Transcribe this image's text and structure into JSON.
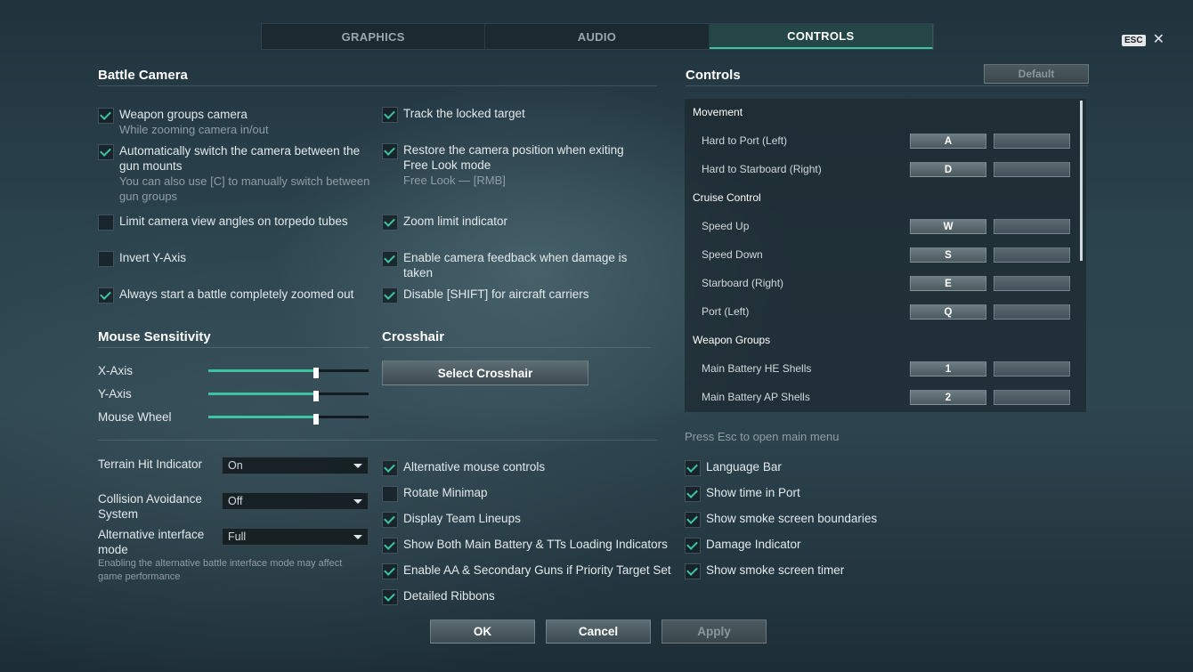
{
  "tabs": [
    {
      "label": "GRAPHICS",
      "active": false
    },
    {
      "label": "AUDIO",
      "active": false
    },
    {
      "label": "CONTROLS",
      "active": true
    }
  ],
  "esc_key": "ESC",
  "battle_camera": {
    "title": "Battle Camera",
    "left": [
      {
        "label": "Weapon groups camera",
        "sub": "While zooming camera in/out",
        "checked": true
      },
      {
        "label": "Automatically switch the camera between the gun mounts",
        "sub": "You can also use [C] to manually switch between gun groups",
        "checked": true
      },
      {
        "label": "Limit camera view angles on torpedo tubes",
        "checked": false
      },
      {
        "label": "Invert Y-Axis",
        "checked": false
      },
      {
        "label": "Always start a battle completely zoomed out",
        "checked": true
      }
    ],
    "right": [
      {
        "label": "Track the locked target",
        "checked": true
      },
      {
        "label": "Restore the camera position when exiting Free Look mode",
        "sub": "Free Look — [RMB]",
        "checked": true
      },
      {
        "label": "Zoom limit indicator",
        "checked": true
      },
      {
        "label": "Enable camera feedback when damage is taken",
        "checked": true
      },
      {
        "label": "Disable [SHIFT] for aircraft carriers",
        "checked": true
      }
    ]
  },
  "mouse_sensitivity": {
    "title": "Mouse Sensitivity",
    "sliders": [
      {
        "label": "X-Axis",
        "value": 0.67
      },
      {
        "label": "Y-Axis",
        "value": 0.67
      },
      {
        "label": "Mouse Wheel",
        "value": 0.67
      }
    ]
  },
  "crosshair": {
    "title": "Crosshair",
    "button": "Select Crosshair"
  },
  "dropdowns": [
    {
      "label": "Terrain Hit Indicator",
      "value": "On"
    },
    {
      "label": "Collision Avoidance System",
      "value": "Off"
    },
    {
      "label": "Alternative interface mode",
      "value": "Full"
    }
  ],
  "alt_interface_note": "Enabling the alternative battle interface mode may affect game performance",
  "middle_options": [
    {
      "label": "Alternative mouse controls",
      "checked": true
    },
    {
      "label": "Rotate Minimap",
      "checked": false
    },
    {
      "label": "Display Team Lineups",
      "checked": true
    },
    {
      "label": "Show Both Main Battery & TTs Loading Indicators",
      "checked": true
    },
    {
      "label": "Enable AA & Secondary Guns if Priority Target Set",
      "checked": true
    },
    {
      "label": "Detailed Ribbons",
      "checked": true
    }
  ],
  "controls": {
    "title": "Controls",
    "default_button": "Default",
    "groups": [
      {
        "name": "Movement",
        "actions": [
          {
            "label": "Hard to Port (Left)",
            "key": "A"
          },
          {
            "label": "Hard to Starboard (Right)",
            "key": "D"
          }
        ]
      },
      {
        "name": "Cruise Control",
        "actions": [
          {
            "label": "Speed Up",
            "key": "W"
          },
          {
            "label": "Speed Down",
            "key": "S"
          },
          {
            "label": "Starboard (Right)",
            "key": "E"
          },
          {
            "label": "Port (Left)",
            "key": "Q"
          }
        ]
      },
      {
        "name": "Weapon Groups",
        "actions": [
          {
            "label": "Main Battery HE Shells",
            "key": "1"
          },
          {
            "label": "Main Battery AP Shells",
            "key": "2"
          }
        ]
      }
    ],
    "hint": "Press Esc to open main menu"
  },
  "right_options": [
    {
      "label": "Language Bar",
      "checked": true
    },
    {
      "label": "Show time in Port",
      "checked": true
    },
    {
      "label": "Show smoke screen boundaries",
      "checked": true
    },
    {
      "label": "Damage Indicator",
      "checked": true
    },
    {
      "label": "Show smoke screen timer",
      "checked": true
    }
  ],
  "footer": {
    "ok": "OK",
    "cancel": "Cancel",
    "apply": "Apply"
  },
  "colors": {
    "accent": "#3fc4a3"
  }
}
